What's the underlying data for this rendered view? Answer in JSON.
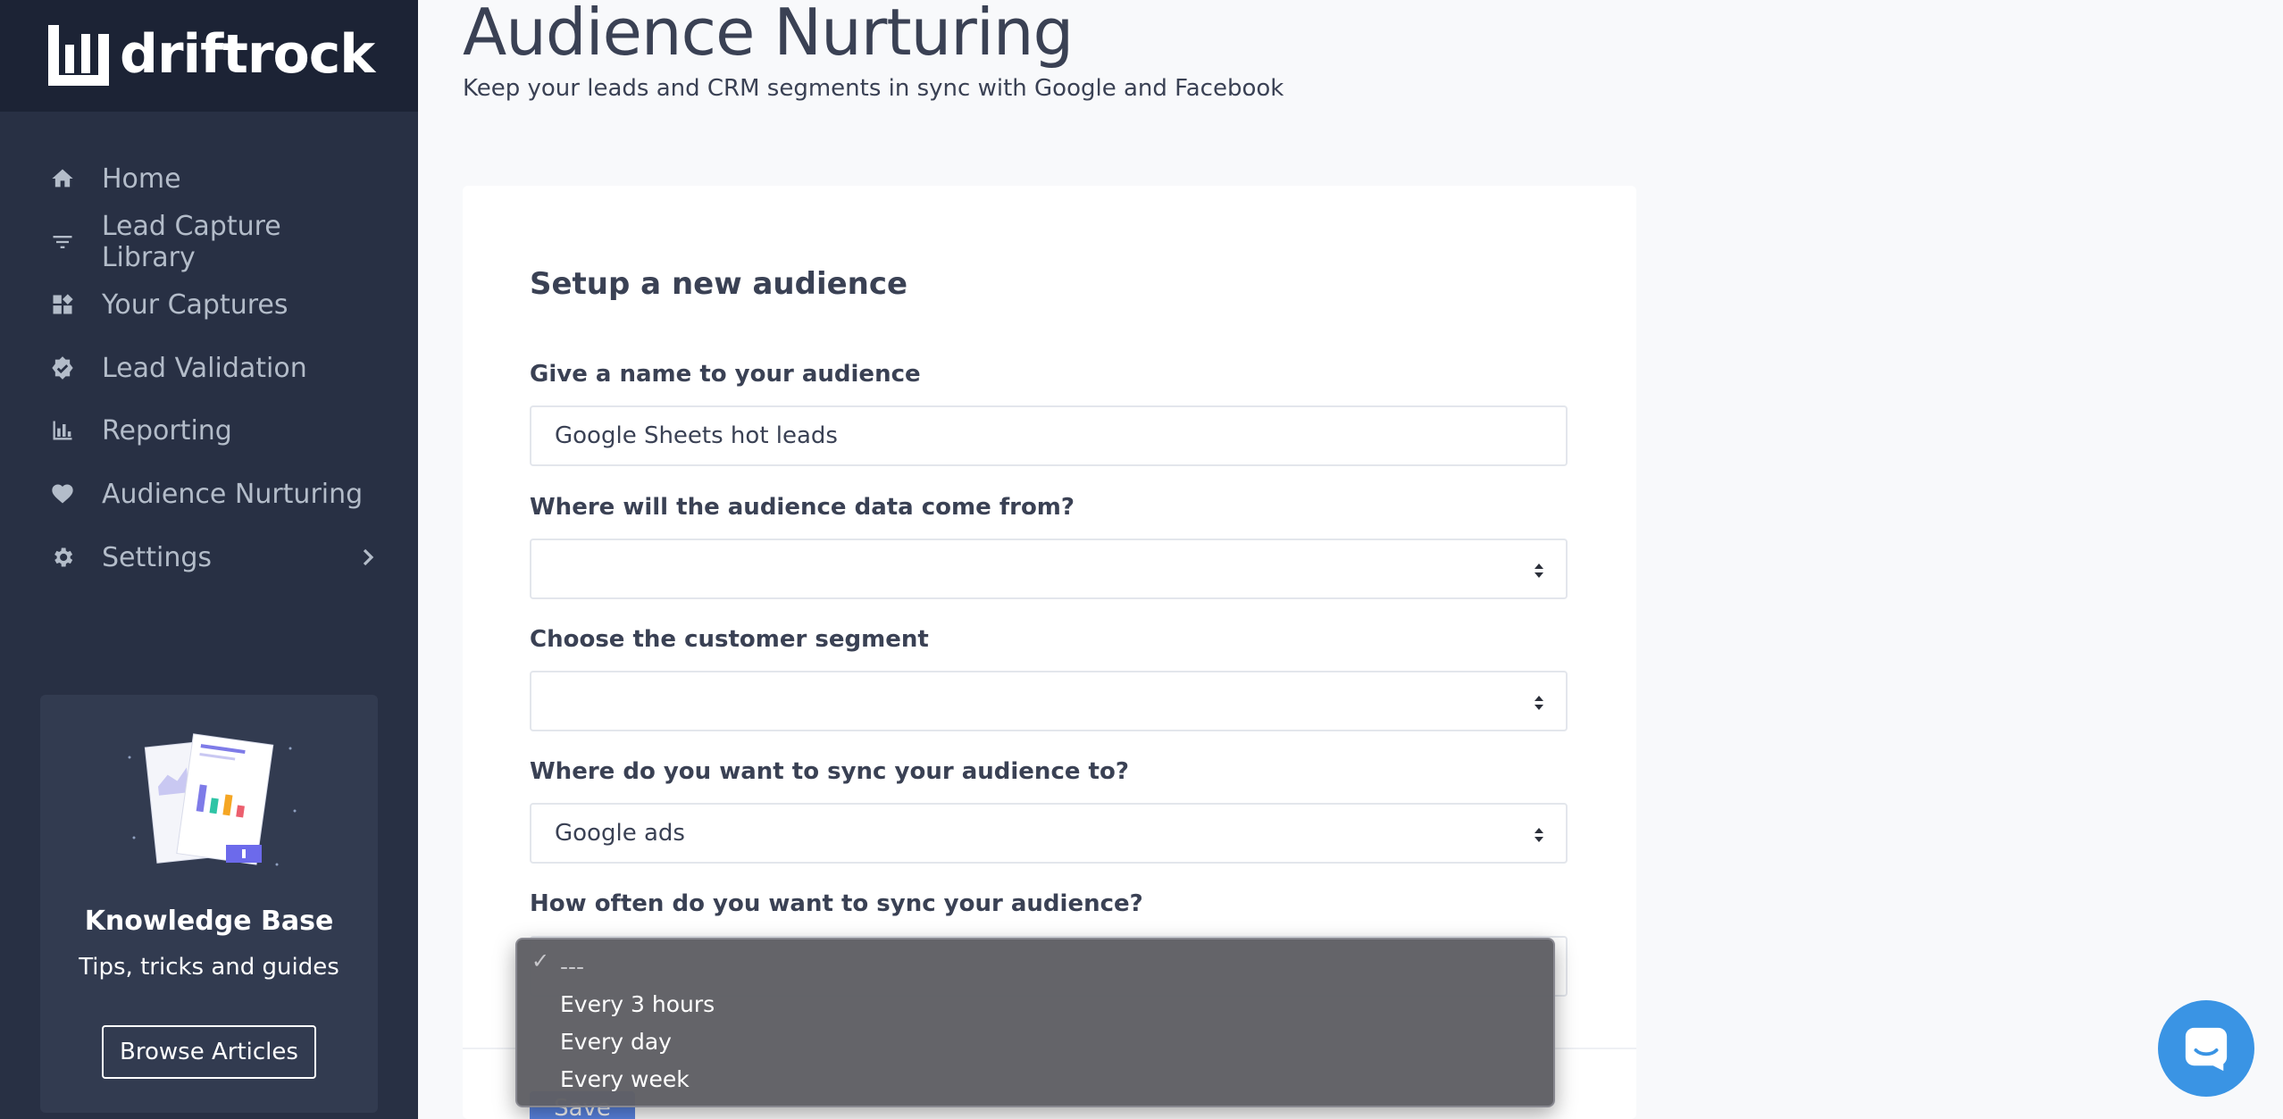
{
  "brand": {
    "name": "driftrock"
  },
  "sidebar": {
    "items": [
      {
        "label": "Home",
        "icon": "home-icon"
      },
      {
        "label": "Lead Capture Library",
        "icon": "filter-icon"
      },
      {
        "label": "Your Captures",
        "icon": "widgets-icon"
      },
      {
        "label": "Lead Validation",
        "icon": "verified-icon"
      },
      {
        "label": "Reporting",
        "icon": "bar-chart-icon"
      },
      {
        "label": "Audience Nurturing",
        "icon": "heart-icon"
      },
      {
        "label": "Settings",
        "icon": "gear-icon"
      }
    ],
    "knowledge_base": {
      "title": "Knowledge Base",
      "subtitle": "Tips, tricks and guides",
      "button": "Browse Articles"
    }
  },
  "page": {
    "title": "Audience Nurturing",
    "subtitle": "Keep your leads and CRM segments in sync with Google and Facebook"
  },
  "form": {
    "title": "Setup a new audience",
    "name_label": "Give a name to your audience",
    "name_value": "Google Sheets hot leads",
    "source_label": "Where will the audience data come from?",
    "source_value": "",
    "segment_label": "Choose the customer segment",
    "segment_value": "",
    "destination_label": "Where do you want to sync your audience to?",
    "destination_value": "Google ads",
    "frequency_label": "How often do you want to sync your audience?",
    "save_label": "Save"
  },
  "dropdown": {
    "options": [
      "---",
      "Every 3 hours",
      "Every day",
      "Every week"
    ],
    "selected_index": 0
  },
  "colors": {
    "sidebar": "#283044",
    "brand_bar": "#1c2335",
    "accent": "#5b86e5",
    "chat": "#3a94e4"
  }
}
